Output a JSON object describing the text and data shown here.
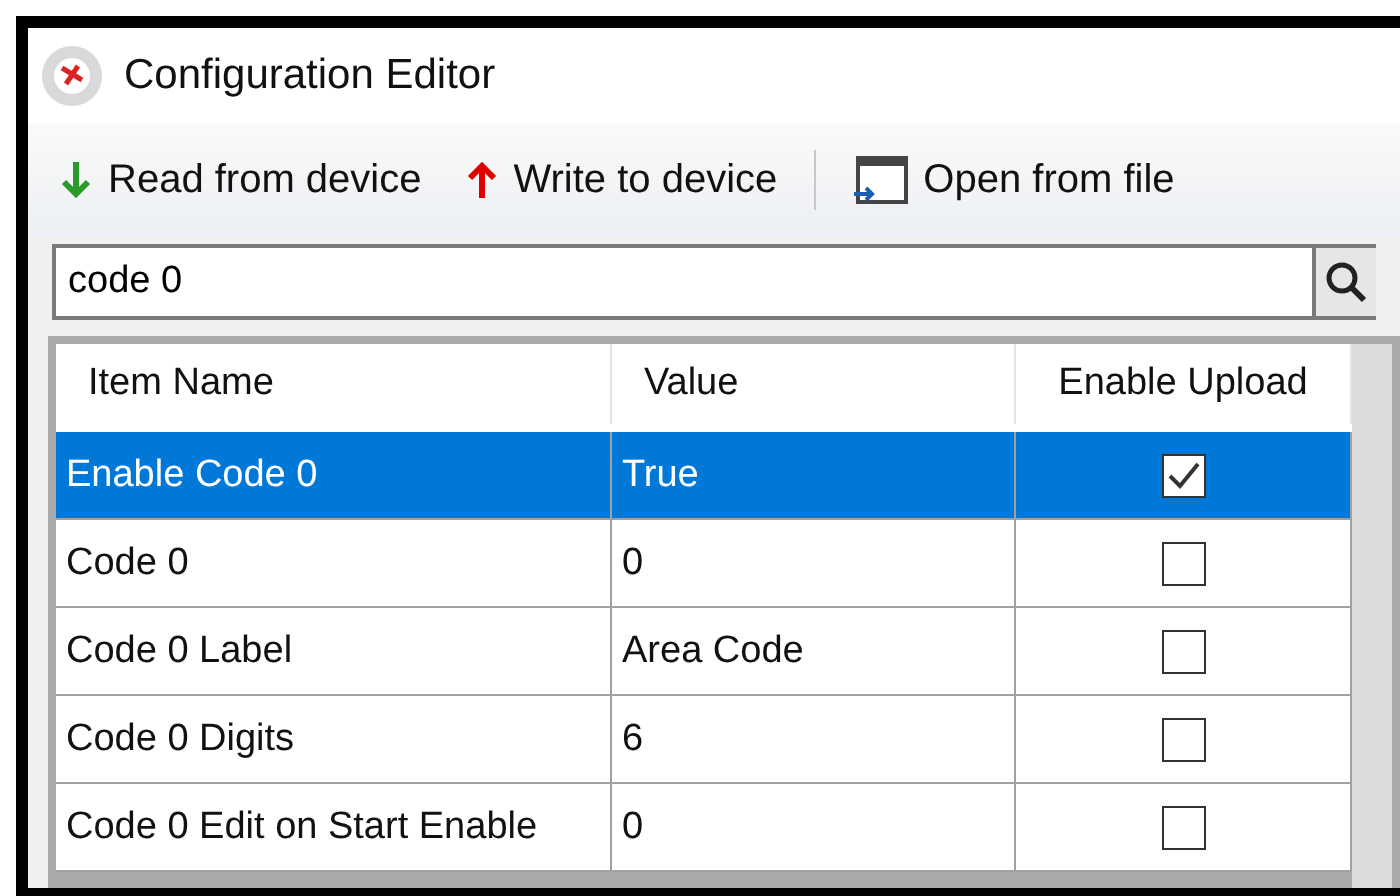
{
  "window": {
    "title": "Configuration Editor"
  },
  "toolbar": [
    {
      "kind": "read",
      "label": "Read from device"
    },
    {
      "kind": "write",
      "label": "Write to device"
    },
    {
      "kind": "open",
      "label": "Open from file"
    }
  ],
  "search": {
    "value": "code 0"
  },
  "table": {
    "columns": [
      "Item Name",
      "Value",
      "Enable Upload"
    ],
    "rows": [
      {
        "name": "Enable Code 0",
        "value": "True",
        "checked": true,
        "selected": true
      },
      {
        "name": "Code 0",
        "value": "0",
        "checked": false,
        "selected": false
      },
      {
        "name": "Code 0 Label",
        "value": "Area Code",
        "checked": false,
        "selected": false
      },
      {
        "name": "Code 0 Digits",
        "value": "6",
        "checked": false,
        "selected": false
      },
      {
        "name": "Code 0 Edit on Start Enable",
        "value": "0",
        "checked": false,
        "selected": false
      }
    ]
  }
}
